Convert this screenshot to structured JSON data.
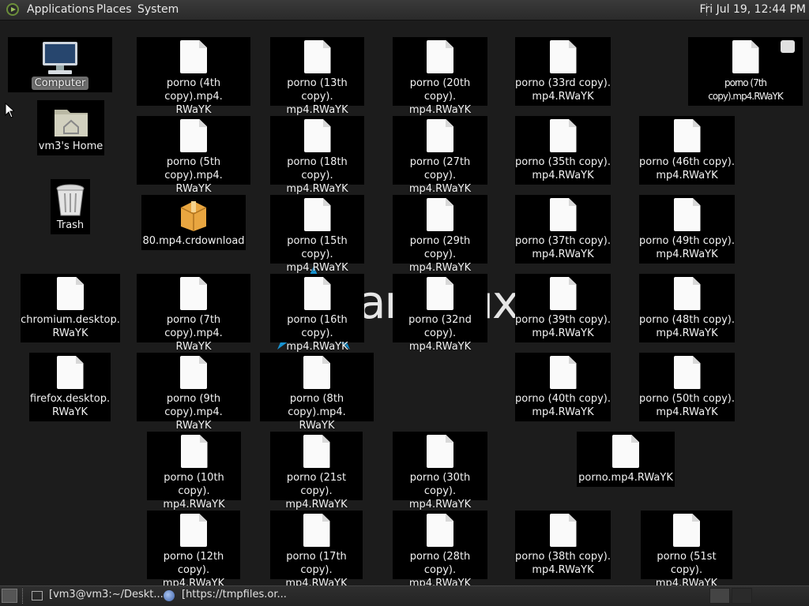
{
  "top_panel": {
    "menus": [
      "Applications",
      "Places",
      "System"
    ],
    "clock": "Fri Jul 19, 12:44 PM"
  },
  "wallpaper": {
    "text": "arch  ux"
  },
  "desktop": {
    "computer": "Computer",
    "home": "vm3's Home",
    "trash": "Trash",
    "download": "80.mp4.crdownload",
    "overlap_label": "porno (7th copy).mp4.RWaYK",
    "files": [
      "porno (4th copy).mp4.\nRWaYK",
      "porno (13th copy).\nmp4.RWaYK",
      "porno (20th copy).\nmp4.RWaYK",
      "porno (33rd copy).\nmp4.RWaYK",
      "porno (5th copy).mp4.\nRWaYK",
      "porno (18th copy).\nmp4.RWaYK",
      "porno (27th copy).\nmp4.RWaYK",
      "porno (35th copy).\nmp4.RWaYK",
      "porno (46th copy).\nmp4.RWaYK",
      "porno (15th copy).\nmp4.RWaYK",
      "porno (29th copy).\nmp4.RWaYK",
      "porno (37th copy).\nmp4.RWaYK",
      "porno (49th copy).\nmp4.RWaYK",
      "chromium.desktop.\nRWaYK",
      "porno (7th copy).mp4.\nRWaYK",
      "porno (16th copy).\nmp4.RWaYK",
      "porno (32nd copy).\nmp4.RWaYK",
      "porno (39th copy).\nmp4.RWaYK",
      "porno (48th copy).\nmp4.RWaYK",
      "firefox.desktop.\nRWaYK",
      "porno (9th copy).mp4.\nRWaYK",
      "porno (8th copy).mp4.\nRWaYK",
      "porno (40th copy).\nmp4.RWaYK",
      "porno (50th copy).\nmp4.RWaYK",
      "porno (10th copy).\nmp4.RWaYK",
      "porno (21st copy).\nmp4.RWaYK",
      "porno (30th copy).\nmp4.RWaYK",
      "porno.mp4.RWaYK",
      "porno (12th copy).\nmp4.RWaYK",
      "porno (17th copy).\nmp4.RWaYK",
      "porno (28th copy).\nmp4.RWaYK",
      "porno (38th copy).\nmp4.RWaYK",
      "porno (51st copy).\nmp4.RWaYK"
    ]
  },
  "taskbar": {
    "terminal": "[vm3@vm3:~/Deskt...",
    "firefox": "[https://tmpfiles.or..."
  }
}
